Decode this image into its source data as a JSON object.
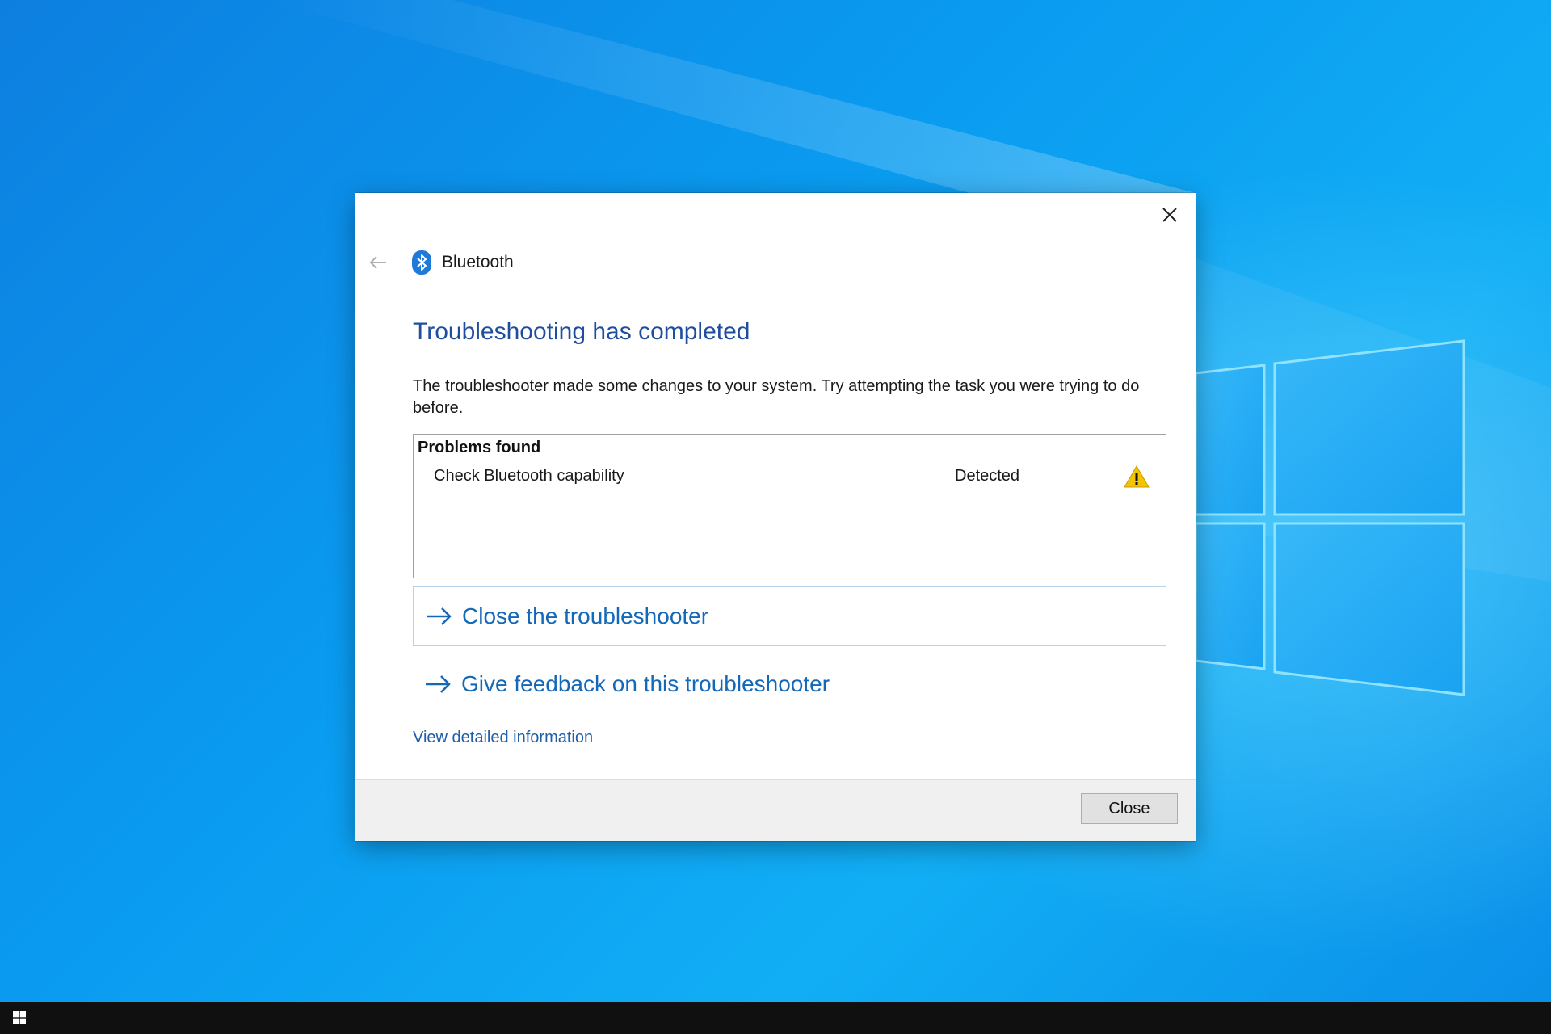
{
  "dialog": {
    "app_title": "Bluetooth",
    "heading": "Troubleshooting has completed",
    "description": "The troubleshooter made some changes to your system. Try attempting the task you were trying to do before.",
    "problems": {
      "header": "Problems found",
      "rows": [
        {
          "name": "Check Bluetooth capability",
          "status": "Detected",
          "icon": "warning-icon"
        }
      ]
    },
    "options": {
      "close_troubleshooter": "Close the troubleshooter",
      "give_feedback": "Give feedback on this troubleshooter"
    },
    "details_link": "View detailed information",
    "close_button": "Close"
  },
  "icons": {
    "close": "close-icon",
    "back": "back-arrow-icon",
    "app": "bluetooth-icon",
    "option_arrow": "arrow-right-icon",
    "start": "windows-logo-icon"
  },
  "colors": {
    "heading": "#1f4e9e",
    "link": "#1468b8",
    "warning": "#f5c400",
    "taskbar": "#101010"
  }
}
